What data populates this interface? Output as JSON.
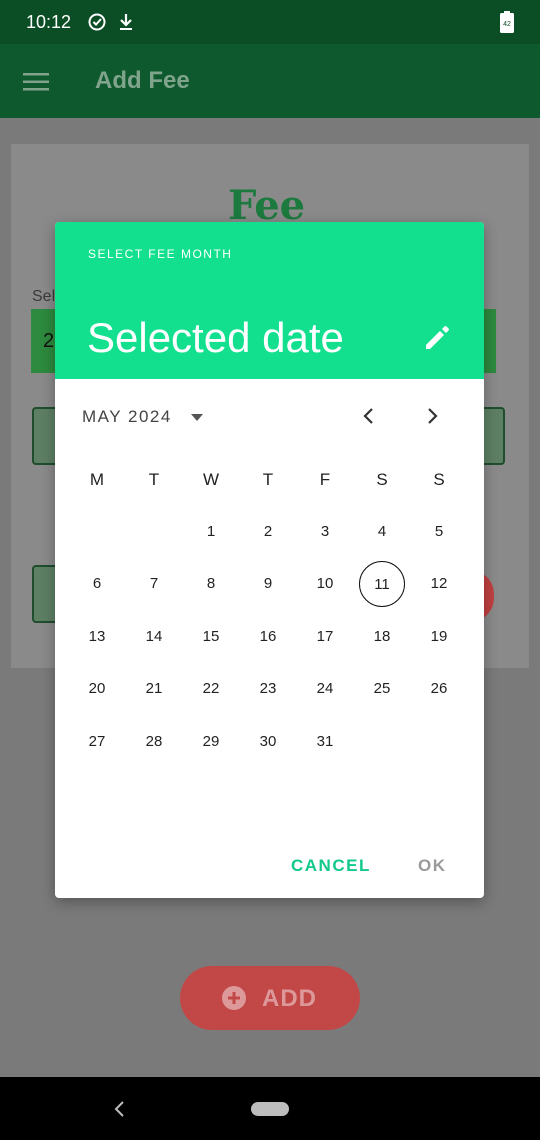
{
  "status_bar": {
    "time": "10:12",
    "battery_level": "42"
  },
  "app_bar": {
    "title": "Add Fee"
  },
  "background": {
    "heading": "Fee",
    "select_label": "Sel",
    "field_value": "2",
    "add_button_label": "ADD",
    "accent_color": "#0e5a2e"
  },
  "dialog": {
    "subtitle": "SELECT FEE MONTH",
    "selected_date": "Selected date",
    "month_label": "MAY 2024",
    "weekdays": [
      "M",
      "T",
      "W",
      "T",
      "F",
      "S",
      "S"
    ],
    "days": [
      "1",
      "2",
      "3",
      "4",
      "5",
      "6",
      "7",
      "8",
      "9",
      "10",
      "11",
      "12",
      "13",
      "14",
      "15",
      "16",
      "17",
      "18",
      "19",
      "20",
      "21",
      "22",
      "23",
      "24",
      "25",
      "26",
      "27",
      "28",
      "29",
      "30",
      "31"
    ],
    "today": "11",
    "cancel_label": "CANCEL",
    "ok_label": "OK",
    "header_color": "#13e08f"
  }
}
